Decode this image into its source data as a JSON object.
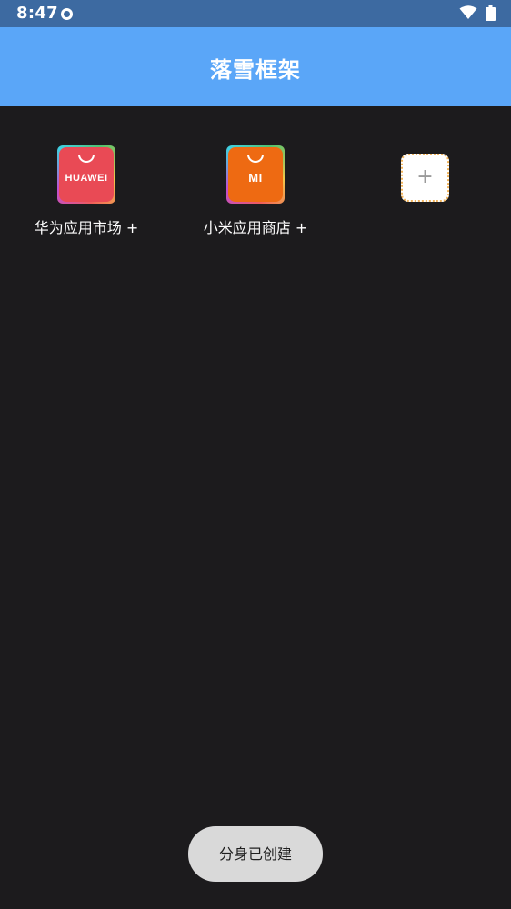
{
  "status_bar": {
    "time": "8:47",
    "icons": [
      "notification-dot-icon",
      "wifi-icon",
      "battery-icon"
    ]
  },
  "app_bar": {
    "title": "落雪框架",
    "color": "#5aa6f8"
  },
  "apps": [
    {
      "label": "华为应用市场 +",
      "brand": "HUAWEI",
      "icon": "huawei-appgallery-icon",
      "color": "#e94a55"
    },
    {
      "label": "小米应用商店 +",
      "brand": "MI",
      "icon": "xiaomi-store-icon",
      "color": "#ee6a12"
    }
  ],
  "add_button": {
    "symbol": "+",
    "icon": "plus-icon"
  },
  "toast": {
    "text": "分身已创建"
  },
  "colors": {
    "background": "#1c1b1d",
    "status_bar": "#3d6aa1"
  }
}
